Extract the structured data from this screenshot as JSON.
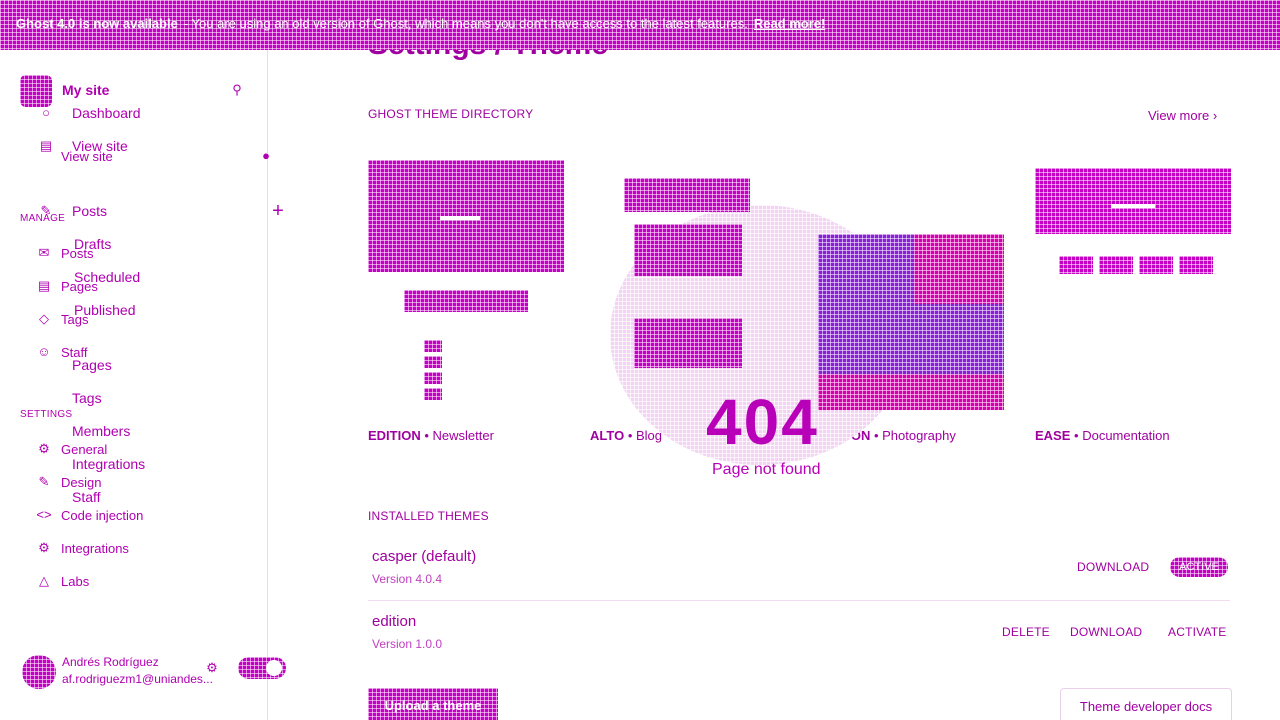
{
  "banner": {
    "headline": "Ghost 4.0 is now available",
    "text": "- You are using an old version of Ghost, which means you don't have access to the latest features.",
    "link": "Read more!"
  },
  "sidebar": {
    "site_name": "My site",
    "ghost_menu": [
      {
        "label": "Dashboard",
        "icon": "dashboard-icon"
      },
      {
        "label": "View site",
        "icon": "view-site-icon"
      },
      {
        "label": "Posts",
        "icon": "posts-icon"
      },
      {
        "label": "Drafts",
        "icon": "drafts-icon"
      },
      {
        "label": "Scheduled",
        "icon": "scheduled-icon"
      },
      {
        "label": "Published",
        "icon": "published-icon"
      },
      {
        "label": "Pages",
        "icon": "pages-icon"
      },
      {
        "label": "Tags",
        "icon": "tags-icon"
      },
      {
        "label": "Members",
        "icon": "members-icon"
      },
      {
        "label": "Integrations",
        "icon": "integrations-icon"
      },
      {
        "label": "Staff",
        "icon": "staff-icon"
      }
    ],
    "manage_heading": "MANAGE",
    "manage_items": [
      {
        "label": "View site"
      },
      {
        "label": "Posts"
      },
      {
        "label": "Pages"
      },
      {
        "label": "Tags"
      },
      {
        "label": "Staff"
      }
    ],
    "settings_heading": "SETTINGS",
    "settings_items": [
      {
        "label": "General"
      },
      {
        "label": "Design"
      },
      {
        "label": "Code injection"
      },
      {
        "label": "Integrations"
      },
      {
        "label": "Labs"
      }
    ],
    "user": {
      "name": "Andrés Rodríguez",
      "email": "af.rodriguezm1@uniandes..."
    }
  },
  "main": {
    "title": "Settings / Theme",
    "directory_heading": "GHOST THEME DIRECTORY",
    "view_more": "View more",
    "themes_directory": [
      {
        "name": "EDITION",
        "category": "• Newsletter"
      },
      {
        "name": "ALTO",
        "category": "• Blog"
      },
      {
        "name": "LONDON",
        "category": "• Photography"
      },
      {
        "name": "EASE",
        "category": "• Documentation"
      }
    ],
    "installed_heading": "INSTALLED THEMES",
    "installed": [
      {
        "name": "casper (default)",
        "version": "Version 4.0.4",
        "actions": [
          "DOWNLOAD"
        ],
        "status": "ACTIVE"
      },
      {
        "name": "edition",
        "version": "Version 1.0.0",
        "actions": [
          "DELETE",
          "DOWNLOAD",
          "ACTIVATE"
        ]
      }
    ],
    "upload_button": "Upload a theme",
    "docs_button": "Theme developer docs"
  },
  "error_overlay": {
    "code": "404",
    "message": "Page not found"
  },
  "colors": {
    "accent": "#c400c4",
    "text": "#a000a0"
  }
}
